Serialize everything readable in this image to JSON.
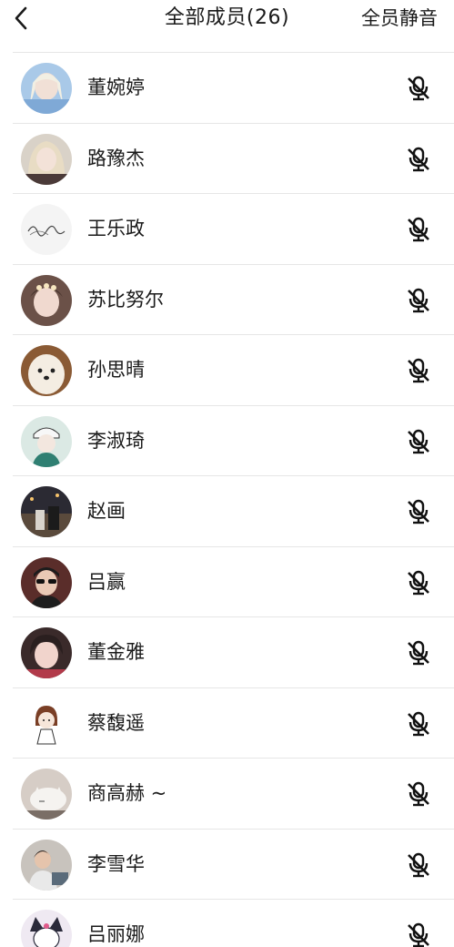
{
  "header": {
    "back_icon": "chevron-left-icon",
    "title": "全部成员(26)",
    "mute_all_label": "全员静音"
  },
  "colors": {
    "text": "#1a1a1a",
    "divider": "#e6e6e6",
    "background": "#ffffff"
  },
  "members": [
    {
      "name": "董婉婷",
      "mic_icon": "mic-muted-icon"
    },
    {
      "name": "路豫杰",
      "mic_icon": "mic-muted-icon"
    },
    {
      "name": "王乐政",
      "mic_icon": "mic-muted-icon"
    },
    {
      "name": "苏比努尔",
      "mic_icon": "mic-muted-icon"
    },
    {
      "name": "孙思晴",
      "mic_icon": "mic-muted-icon"
    },
    {
      "name": "李淑琦",
      "mic_icon": "mic-muted-icon"
    },
    {
      "name": "赵画",
      "mic_icon": "mic-muted-icon"
    },
    {
      "name": "吕赢",
      "mic_icon": "mic-muted-icon"
    },
    {
      "name": "董金雅",
      "mic_icon": "mic-muted-icon"
    },
    {
      "name": "蔡馥遥",
      "mic_icon": "mic-muted-icon"
    },
    {
      "name": "商高赫 ~",
      "mic_icon": "mic-muted-icon"
    },
    {
      "name": "李雪华",
      "mic_icon": "mic-muted-icon"
    },
    {
      "name": "吕丽娜",
      "mic_icon": "mic-muted-icon"
    }
  ]
}
